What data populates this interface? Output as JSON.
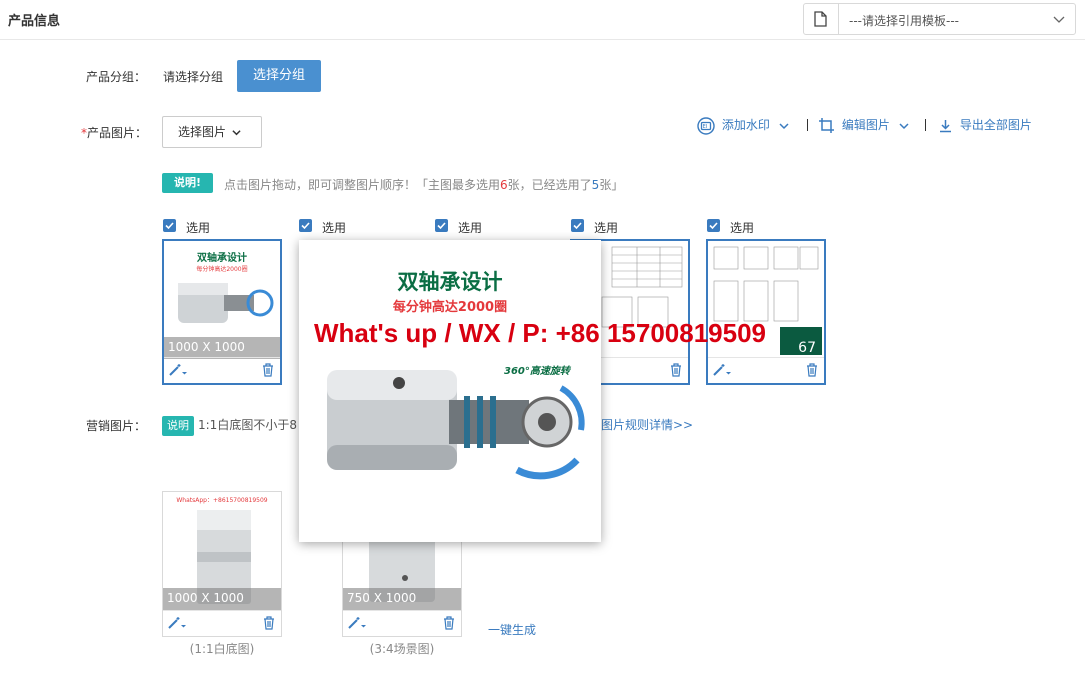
{
  "header": {
    "title": "产品信息",
    "template_select": {
      "value": "---请选择引用模板---"
    }
  },
  "product_group": {
    "label": "产品分组：",
    "current_value": "请选择分组",
    "button_label": "选择分组"
  },
  "product_images": {
    "required_mark": "*",
    "label": "产品图片：",
    "select_button_label": "选择图片",
    "toolbar": {
      "watermark_label": "添加水印",
      "edit_label": "编辑图片",
      "export_label": "导出全部图片"
    },
    "hint": {
      "badge": "说明!",
      "text_before": "点击图片拖动，即可调整图片顺序！「主图最多选用",
      "max_count": "6",
      "text_mid": "张，已经选用了",
      "selected_count": "5",
      "text_after": "张」"
    },
    "items": [
      {
        "select_label": "选用",
        "size": "1000 X 1000"
      },
      {
        "select_label": "选用"
      },
      {
        "select_label": "选用"
      },
      {
        "select_label": "选用"
      },
      {
        "select_label": "选用",
        "size_partial": "67"
      }
    ]
  },
  "marketing_images": {
    "label": "营销图片：",
    "hint_badge": "说明",
    "hint_text_visible": "1:1白底图不小于8",
    "rules_link": "图片规则详情>>",
    "items": [
      {
        "size": "1000 X 1000",
        "caption": "(1:1白底图)",
        "whatsapp_label": "WhatsApp：+8615700819509"
      },
      {
        "size": "750 X 1000",
        "caption": "(3:4场景图)"
      }
    ],
    "generate_link": "一键生成"
  },
  "preview_overlay": {
    "heading": "双轴承设计",
    "subheading": "每分钟高达2000圈",
    "rotation_label": "360°高速旋转",
    "watermark_text": "What's up / WX / P: +86 15700819509",
    "thumb_heading": "双轴承设计",
    "thumb_subheading": "每分钟高达2000圈"
  },
  "colors": {
    "accent": "#4a90d0",
    "link": "#3a7bbf",
    "hint_badge": "#26b6b0",
    "required": "#e4393c",
    "watermark": "#d80010"
  }
}
